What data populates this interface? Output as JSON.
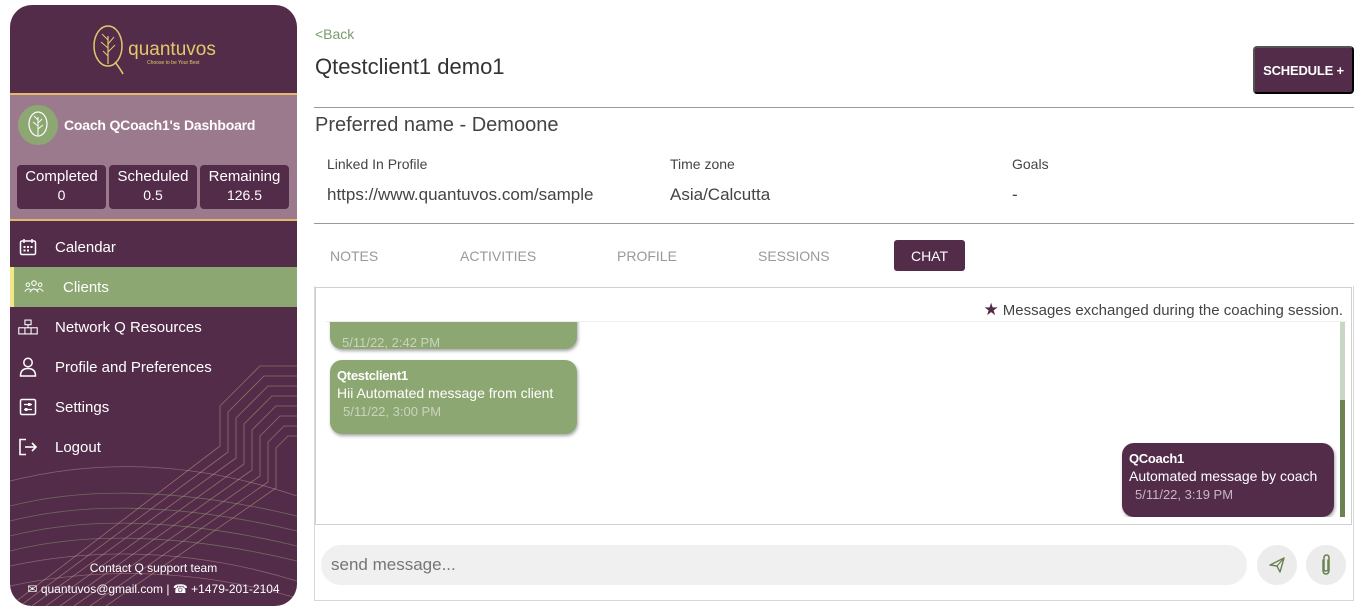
{
  "sidebar": {
    "logo_text": "quantuvos",
    "logo_tagline": "Choose to be Your Best",
    "dashboard_title": "Coach QCoach1's Dashboard",
    "stats": [
      {
        "label": "Completed",
        "value": "0"
      },
      {
        "label": "Scheduled",
        "value": "0.5"
      },
      {
        "label": "Remaining",
        "value": "126.5"
      }
    ],
    "items": [
      {
        "label": "Calendar",
        "icon": "calendar-icon"
      },
      {
        "label": "Clients",
        "icon": "users-icon"
      },
      {
        "label": "Network Q Resources",
        "icon": "network-icon"
      },
      {
        "label": "Profile and Preferences",
        "icon": "person-icon"
      },
      {
        "label": "Settings",
        "icon": "settings-icon"
      },
      {
        "label": "Logout",
        "icon": "logout-icon"
      }
    ],
    "active_item": "Clients",
    "contact_title": "Contact Q support team",
    "contact_email": "quantuvos@gmail.com",
    "contact_separator": "|",
    "contact_phone": "+1479-201-2104"
  },
  "header": {
    "back_label": "<Back",
    "client_name": "Qtestclient1 demo1",
    "schedule_label": "SCHEDULE +"
  },
  "profile": {
    "preferred_name": "Preferred name  - Demoone",
    "fields": [
      {
        "label": "Linked In Profile",
        "value": "https://www.quantuvos.com/sample"
      },
      {
        "label": "Time zone",
        "value": "Asia/Calcutta"
      },
      {
        "label": "Goals",
        "value": "-"
      }
    ]
  },
  "tabs": [
    {
      "label": "NOTES"
    },
    {
      "label": "ACTIVITIES"
    },
    {
      "label": "PROFILE"
    },
    {
      "label": "SESSIONS"
    },
    {
      "label": "CHAT"
    }
  ],
  "active_tab": "CHAT",
  "chat": {
    "note": "Messages exchanged during the coaching session.",
    "messages": [
      {
        "sender": "",
        "text": "",
        "time": "5/11/22, 2:42 PM",
        "from": "client"
      },
      {
        "sender": "Qtestclient1",
        "text": "Hii Automated message from client",
        "time": "5/11/22, 3:00 PM",
        "from": "client"
      },
      {
        "sender": "QCoach1",
        "text": "Automated message by coach",
        "time": "5/11/22, 3:19 PM",
        "from": "coach"
      }
    ],
    "input_placeholder": "send message..."
  },
  "colors": {
    "brand_purple": "#532c4a",
    "brand_green": "#8da772",
    "brand_gold": "#e4c76b"
  }
}
